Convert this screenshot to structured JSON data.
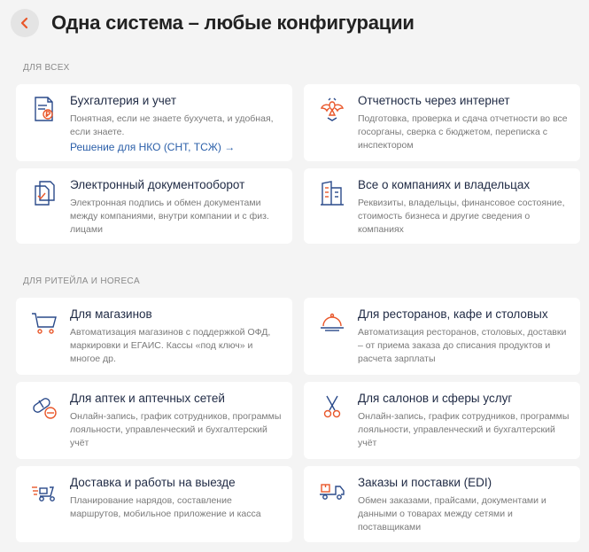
{
  "header": {
    "title": "Одна система – любые конфигурации",
    "back_icon": "chevron-left-icon"
  },
  "colors": {
    "accent": "#e9572a",
    "icon_blue": "#2a4a8a",
    "link": "#2b5fa9",
    "background": "#f4f4f4",
    "card": "#ffffff"
  },
  "sections": [
    {
      "label": "ДЛЯ ВСЕХ",
      "cards": [
        {
          "icon": "accounting-document-icon",
          "title": "Бухгалтерия и учет",
          "desc": "Понятная, если не знаете бухучета, и удобная, если знаете.",
          "link": "Решение для НКО (СНТ, ТСЖ) →"
        },
        {
          "icon": "eagle-emblem-icon",
          "title": "Отчетность через интернет",
          "desc": "Подготовка, проверка и сдача отчетности во все госорганы, сверка с бюджетом, переписка с инспектором"
        },
        {
          "icon": "document-check-icon",
          "title": "Электронный документооборот",
          "desc": "Электронная подпись и обмен документами между компаниями, внутри компании и с физ. лицами"
        },
        {
          "icon": "buildings-icon",
          "title": "Все о компаниях и владельцах",
          "desc": "Реквизиты, владельцы, финансовое состояние, стоимость бизнеса и другие сведения о компаниях"
        }
      ]
    },
    {
      "label": "ДЛЯ РИТЕЙЛА И HORECA",
      "cards": [
        {
          "icon": "shopping-cart-icon",
          "title": "Для магазинов",
          "desc": "Автоматизация магазинов с поддержкой ОФД, маркировки и ЕГАИС. Кассы «под ключ» и многое др."
        },
        {
          "icon": "cloche-icon",
          "title": "Для ресторанов, кафе и столовых",
          "desc": "Автоматизация ресторанов, столовых, доставки – от приема заказа до списания продуктов и расчета зарплаты"
        },
        {
          "icon": "pills-icon",
          "title": "Для аптек и аптечных сетей",
          "desc": "Онлайн-запись, график сотрудников, программы лояльности, управленческий и бухгалтерский учёт"
        },
        {
          "icon": "scissors-icon",
          "title": "Для салонов и сферы услуг",
          "desc": "Онлайн-запись, график сотрудников, программы лояльности, управленческий и бухгалтерский учёт"
        },
        {
          "icon": "delivery-scooter-icon",
          "title": "Доставка и работы на выезде",
          "desc": "Планирование нарядов, составление маршрутов, мобильное приложение и касса"
        },
        {
          "icon": "delivery-truck-icon",
          "title": "Заказы и поставки (EDI)",
          "desc": "Обмен заказами, прайсами, документами и данными о товарах между сетями и поставщиками"
        }
      ]
    }
  ]
}
